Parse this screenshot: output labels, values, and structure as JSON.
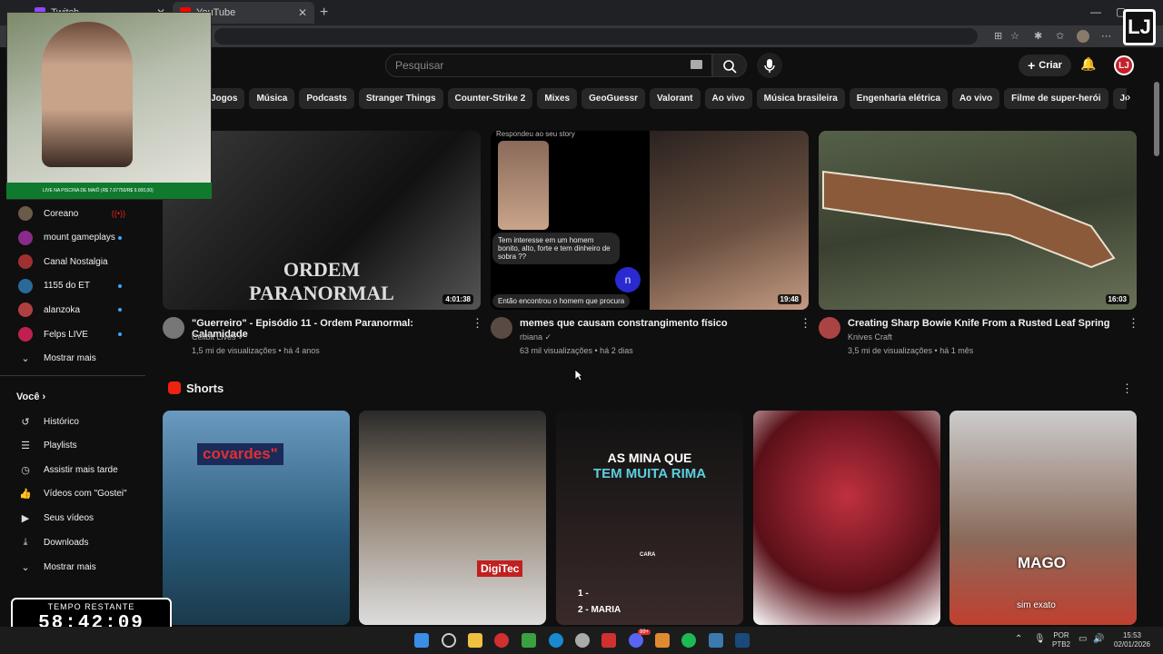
{
  "browser": {
    "tabs": [
      {
        "label": "Twitch"
      },
      {
        "label": "YouTube"
      }
    ],
    "new_tab": "+",
    "win_min": "—",
    "win_max": "▢",
    "win_close": "✕",
    "brand": "LJ"
  },
  "header": {
    "search_placeholder": "Pesquisar",
    "create_label": "Criar",
    "create_plus": "+",
    "account_initials": "LJ"
  },
  "chips": [
    "Jogos",
    "Música",
    "Podcasts",
    "Stranger Things",
    "Counter-Strike 2",
    "Mixes",
    "GeoGuessr",
    "Valorant",
    "Ao vivo",
    "Música brasileira",
    "Engenharia elétrica",
    "Ao vivo",
    "Filme de super-herói",
    "Jogos de simu"
  ],
  "sidebar": {
    "subscriptions": [
      {
        "label": "Coreano",
        "color": "#6a5a4a",
        "status": "live"
      },
      {
        "label": "mount gameplays",
        "color": "#8a2a8a",
        "status": "new"
      },
      {
        "label": "Canal Nostalgia",
        "color": "#a03030",
        "status": ""
      },
      {
        "label": "1155 do ET",
        "color": "#2a6a9a",
        "status": "new"
      },
      {
        "label": "alanzoka",
        "color": "#b04040",
        "status": "new"
      },
      {
        "label": "Felps LIVE",
        "color": "#c02050",
        "status": "new"
      }
    ],
    "show_more": "Mostrar mais",
    "you_label": "Você",
    "you_items": [
      {
        "label": "Histórico",
        "icon": "↺"
      },
      {
        "label": "Playlists",
        "icon": "☰"
      },
      {
        "label": "Assistir mais tarde",
        "icon": "◷"
      },
      {
        "label": "Vídeos com \"Gostei\"",
        "icon": "👍"
      },
      {
        "label": "Seus vídeos",
        "icon": "▶"
      },
      {
        "label": "Downloads",
        "icon": "⤓"
      }
    ],
    "show_more_2": "Mostrar mais"
  },
  "videos": [
    {
      "title": "\"Guerreiro\" - Episódio 11 - Ordem Paranormal: Calamidade",
      "channel": "Cellbit Lives",
      "verified": "✓",
      "meta": "1,5 mi de visualizações • há 4 anos",
      "duration": "4:01:38",
      "thumb_text": "ORDEM PARANORMAL CALAMIDADE"
    },
    {
      "title": "memes que causam constrangimento físico",
      "channel": "rbiana",
      "verified": "✓",
      "meta": "63 mil visualizações • há 2 dias",
      "duration": "19:48",
      "story": "Respondeu ao seu story",
      "bubble1": "Tem interesse em um homem bonito, alto, forte e tem dinheiro de sobra ??",
      "bubble2": "Então encontrou o homem que procura",
      "avatar_letter": "n"
    },
    {
      "title": "Creating Sharp Bowie Knife From a Rusted Leaf Spring",
      "channel": "Knives Craft",
      "verified": "",
      "meta": "3,5 mi de visualizações • há 1 mês",
      "duration": "16:03"
    }
  ],
  "shorts": {
    "title": "Shorts",
    "items": [
      {
        "overlay": "covardes\""
      },
      {
        "overlay": "DigiTec"
      },
      {
        "overlay": "AS MINA QUE",
        "overlay2": "TEM MUITA RIMA",
        "mic_label": "CARA",
        "lyric": "1 -",
        "lyric2": "2 - MARIA"
      },
      {
        "overlay": ""
      },
      {
        "overlay": "MAGO",
        "caption": "sim exato"
      }
    ]
  },
  "stream": {
    "webcam_banner": "LIVE NA PISCINA DE MAIÔ (R$ 7.07750/R$ 9.000,00)",
    "timer_label": "TEMPO RESTANTE",
    "timer_value": "58:42:09"
  },
  "taskbar": {
    "lang": "POR",
    "lang2": "PTB2",
    "time": "15:53",
    "date": "02/01/2026",
    "badge": "99+"
  },
  "colors": {
    "accent": "#ff0000",
    "background": "#0f0f0f",
    "chip": "#272727",
    "verified": "#aaaaaa"
  }
}
